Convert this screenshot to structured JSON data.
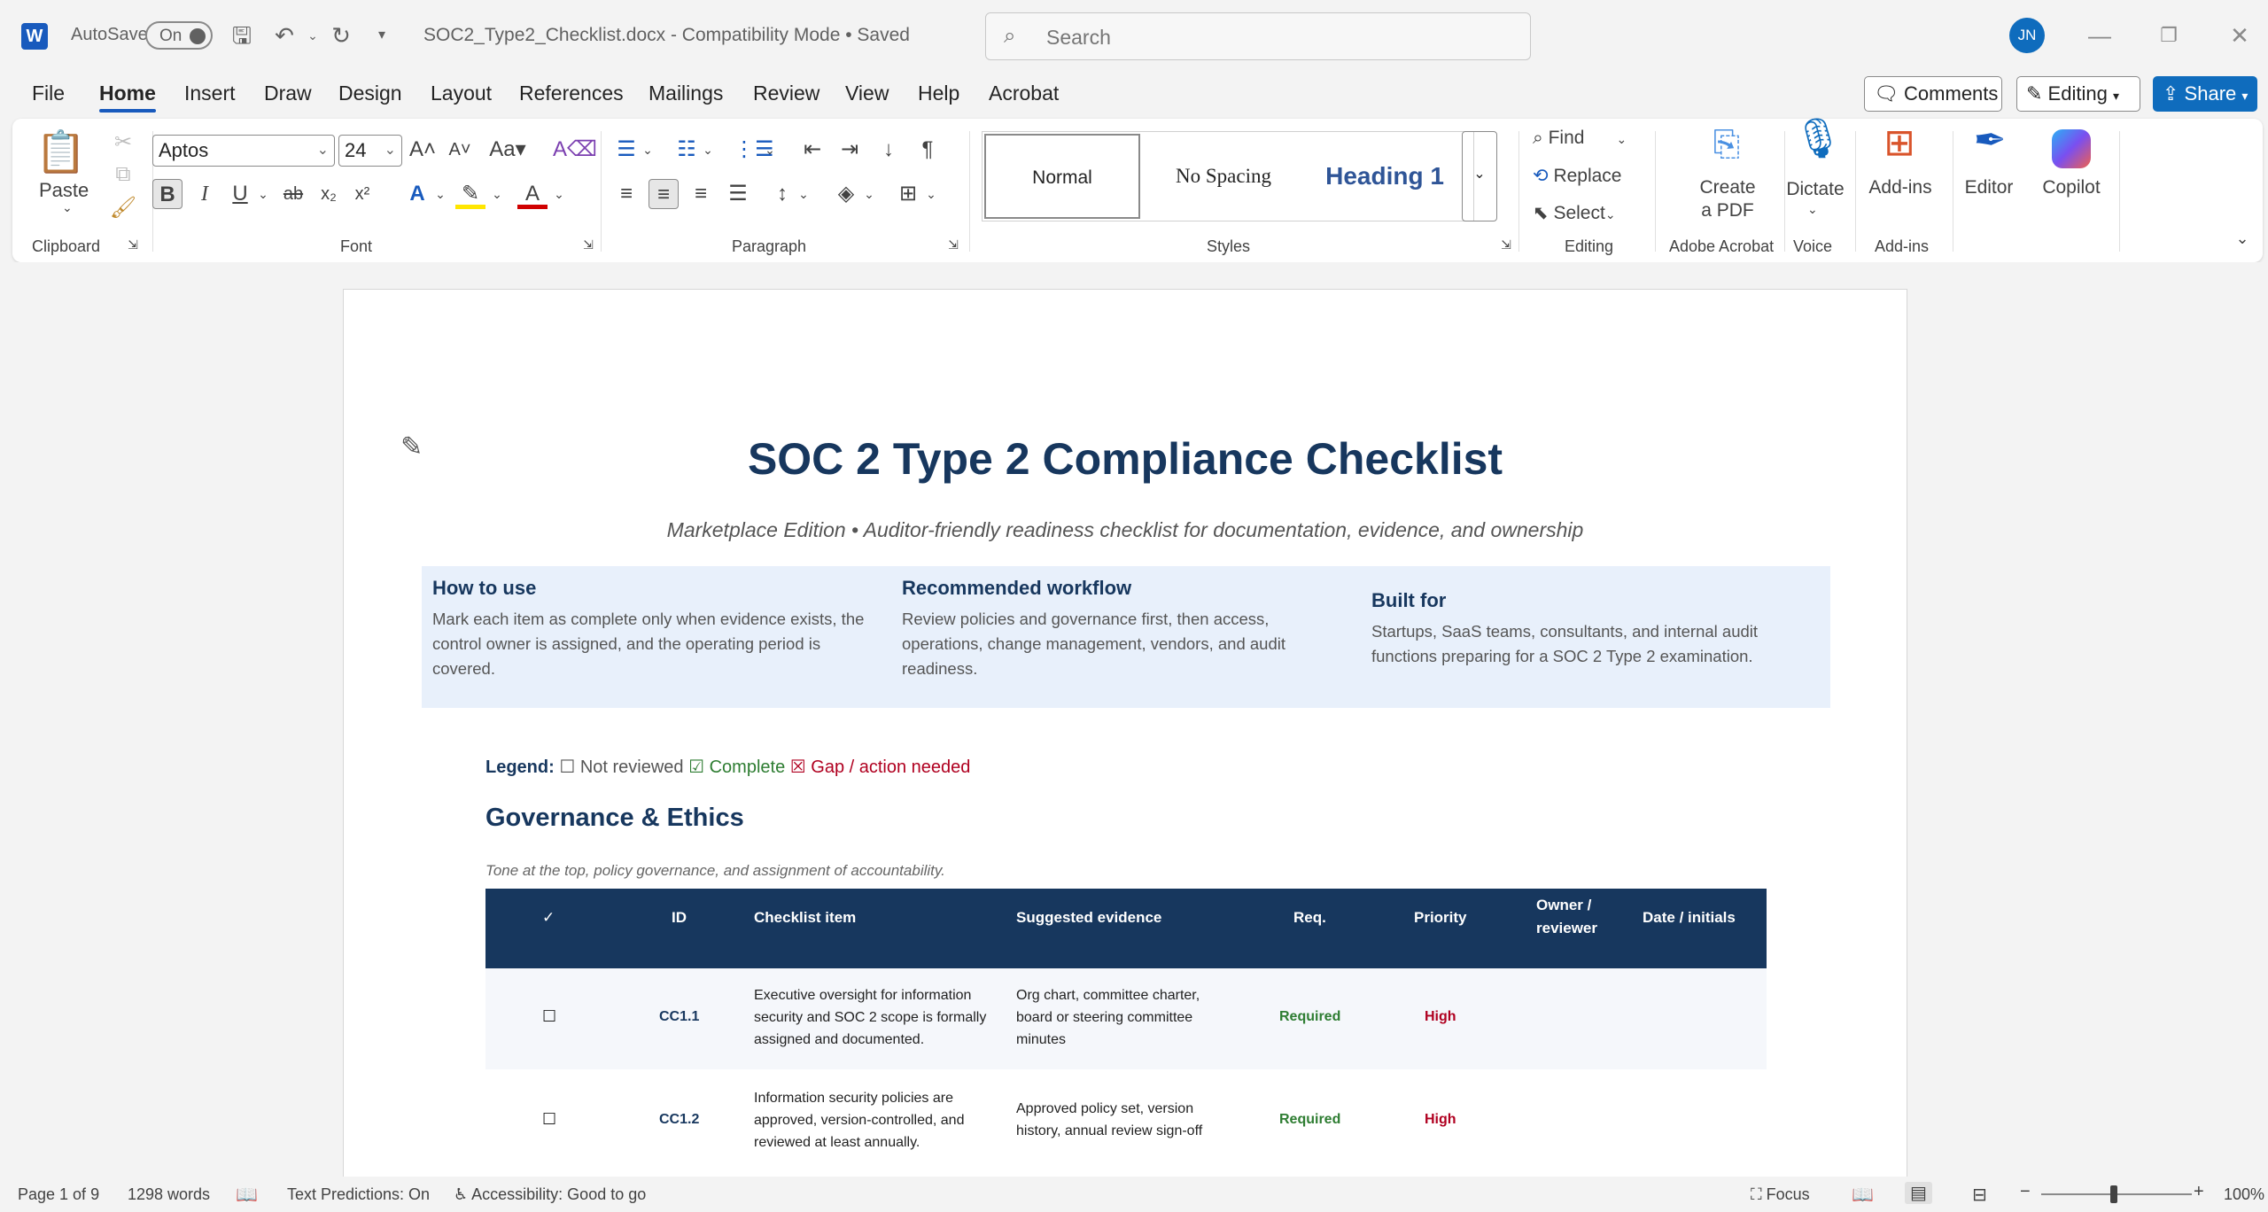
{
  "titlebar": {
    "autosave_label": "AutoSave",
    "autosave_state": "On",
    "doc_title": "SOC2_Type2_Checklist.docx  -  Compatibility Mode • Saved",
    "search_placeholder": "Search",
    "avatar_initials": "JN"
  },
  "menu": {
    "tabs": [
      "File",
      "Home",
      "Insert",
      "Draw",
      "Design",
      "Layout",
      "References",
      "Mailings",
      "Review",
      "View",
      "Help",
      "Acrobat"
    ],
    "comments_label": "Comments",
    "editing_label": "Editing",
    "share_label": "Share"
  },
  "ribbon": {
    "clipboard": {
      "paste": "Paste",
      "label": "Clipboard"
    },
    "font": {
      "name": "Aptos",
      "size": "24",
      "label": "Font"
    },
    "paragraph": {
      "label": "Paragraph"
    },
    "styles": {
      "normal": "Normal",
      "no_spacing": "No Spacing",
      "heading1": "Heading 1",
      "label": "Styles"
    },
    "editing": {
      "find": "Find",
      "replace": "Replace",
      "select": "Select",
      "label": "Editing"
    },
    "acrobat": {
      "create": "Create",
      "create2": "a PDF",
      "label": "Adobe Acrobat"
    },
    "voice": {
      "dictate": "Dictate",
      "label": "Voice"
    },
    "addins": {
      "addins": "Add-ins",
      "label": "Add-ins"
    },
    "editor": "Editor",
    "copilot": "Copilot"
  },
  "document": {
    "title": "SOC 2 Type 2 Compliance Checklist",
    "subtitle": "Marketplace Edition • Auditor-friendly readiness checklist for documentation, evidence, and ownership",
    "info": [
      {
        "heading": "How to use",
        "text": "Mark each item as complete only when evidence exists, the control owner is assigned, and the operating period is covered."
      },
      {
        "heading": "Recommended workflow",
        "text": "Review policies and governance first, then access, operations, change management, vendors, and audit readiness."
      },
      {
        "heading": "Built for",
        "text": "Startups, SaaS teams, consultants, and internal audit functions preparing for a SOC 2 Type 2 examination."
      }
    ],
    "legend": {
      "label": "Legend:",
      "not_reviewed": "☐ Not reviewed",
      "complete": "☑ Complete",
      "gap": "☒ Gap / action needed"
    },
    "section_title": "Governance & Ethics",
    "section_desc": "Tone at the top, policy governance, and assignment of accountability.",
    "table": {
      "headers": [
        "✓",
        "ID",
        "Checklist item",
        "Suggested evidence",
        "Req.",
        "Priority",
        "Owner / reviewer",
        "Date / initials"
      ],
      "rows": [
        {
          "check": "☐",
          "id": "CC1.1",
          "item": "Executive oversight for information security and SOC 2 scope is formally assigned and documented.",
          "evidence": "Org chart, committee charter, board or steering committee minutes",
          "req": "Required",
          "priority": "High"
        },
        {
          "check": "☐",
          "id": "CC1.2",
          "item": "Information security policies are approved, version-controlled, and reviewed at least annually.",
          "evidence": "Approved policy set, version history, annual review sign-off",
          "req": "Required",
          "priority": "High"
        }
      ]
    }
  },
  "status": {
    "page": "Page 1 of 9",
    "words": "1298 words",
    "predictions": "Text Predictions: On",
    "accessibility": "Accessibility: Good to go",
    "focus": "Focus",
    "zoom": "100%"
  },
  "colors": {
    "accent": "#185abd",
    "heading": "#17375e",
    "band": "#e8f0fb",
    "required": "#2e7d32",
    "high": "#b00020"
  }
}
